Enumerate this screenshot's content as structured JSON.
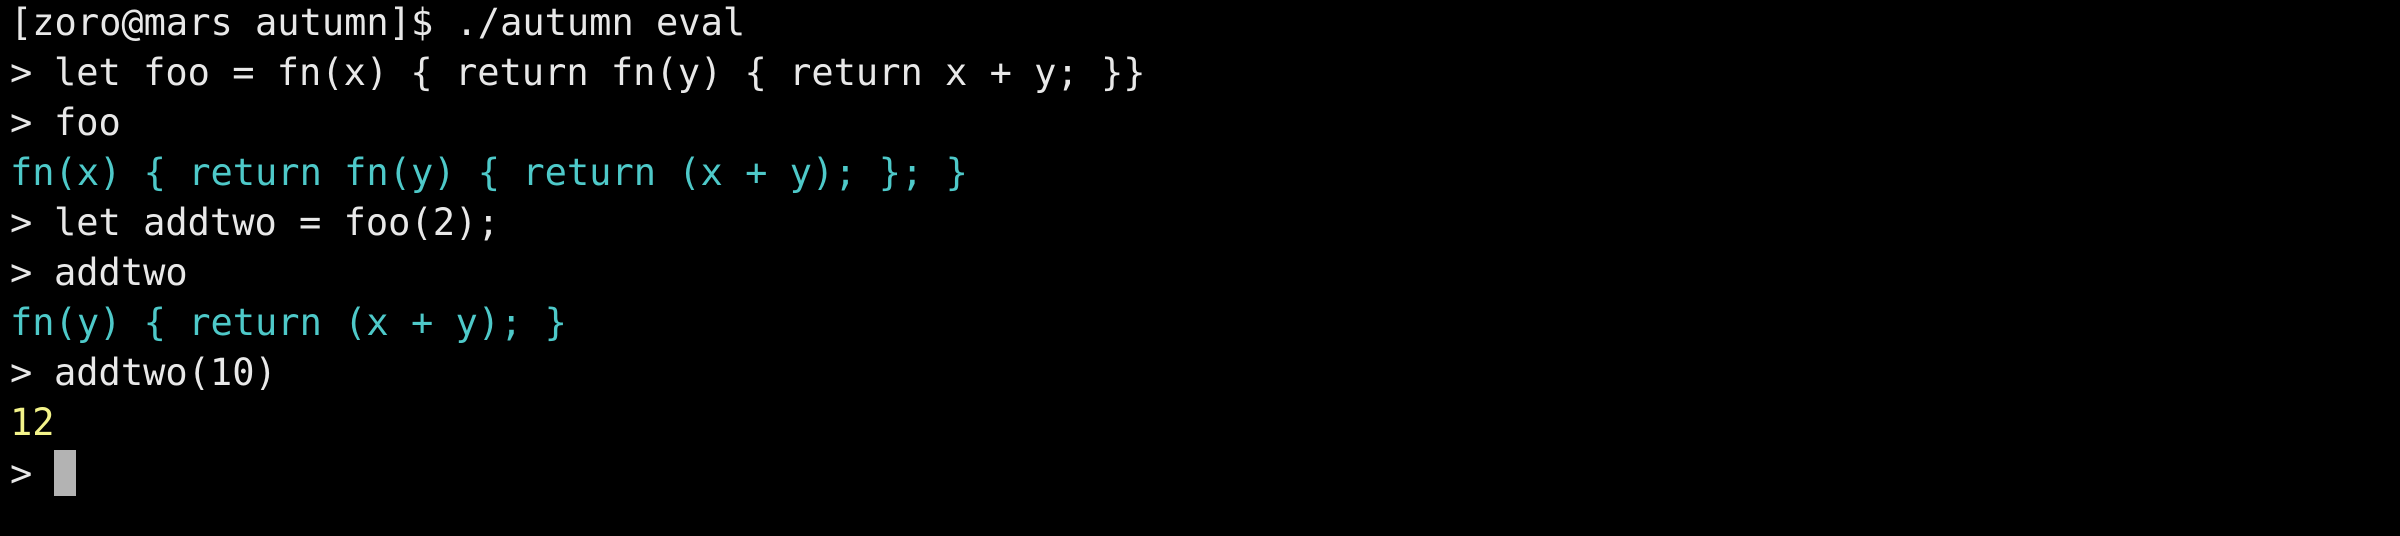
{
  "colors": {
    "background": "#000000",
    "foreground": "#e8e8e8",
    "output_function": "#4ec9c9",
    "output_number": "#f3f38a",
    "cursor": "#b3b3b3"
  },
  "terminal": {
    "shell_prompt": "[zoro@mars autumn]$",
    "shell_command": "./autumn eval",
    "repl_prompt": ">",
    "lines": [
      {
        "kind": "input",
        "text": "let foo = fn(x) { return fn(y) { return x + y; }}"
      },
      {
        "kind": "input",
        "text": "foo"
      },
      {
        "kind": "output",
        "style": "function",
        "text": "fn(x) { return fn(y) { return (x + y); }; }"
      },
      {
        "kind": "input",
        "text": "let addtwo = foo(2);"
      },
      {
        "kind": "input",
        "text": "addtwo"
      },
      {
        "kind": "output",
        "style": "function",
        "text": "fn(y) { return (x + y); }"
      },
      {
        "kind": "input",
        "text": "addtwo(10)"
      },
      {
        "kind": "output",
        "style": "number",
        "text": "12"
      }
    ],
    "active_input": ""
  }
}
